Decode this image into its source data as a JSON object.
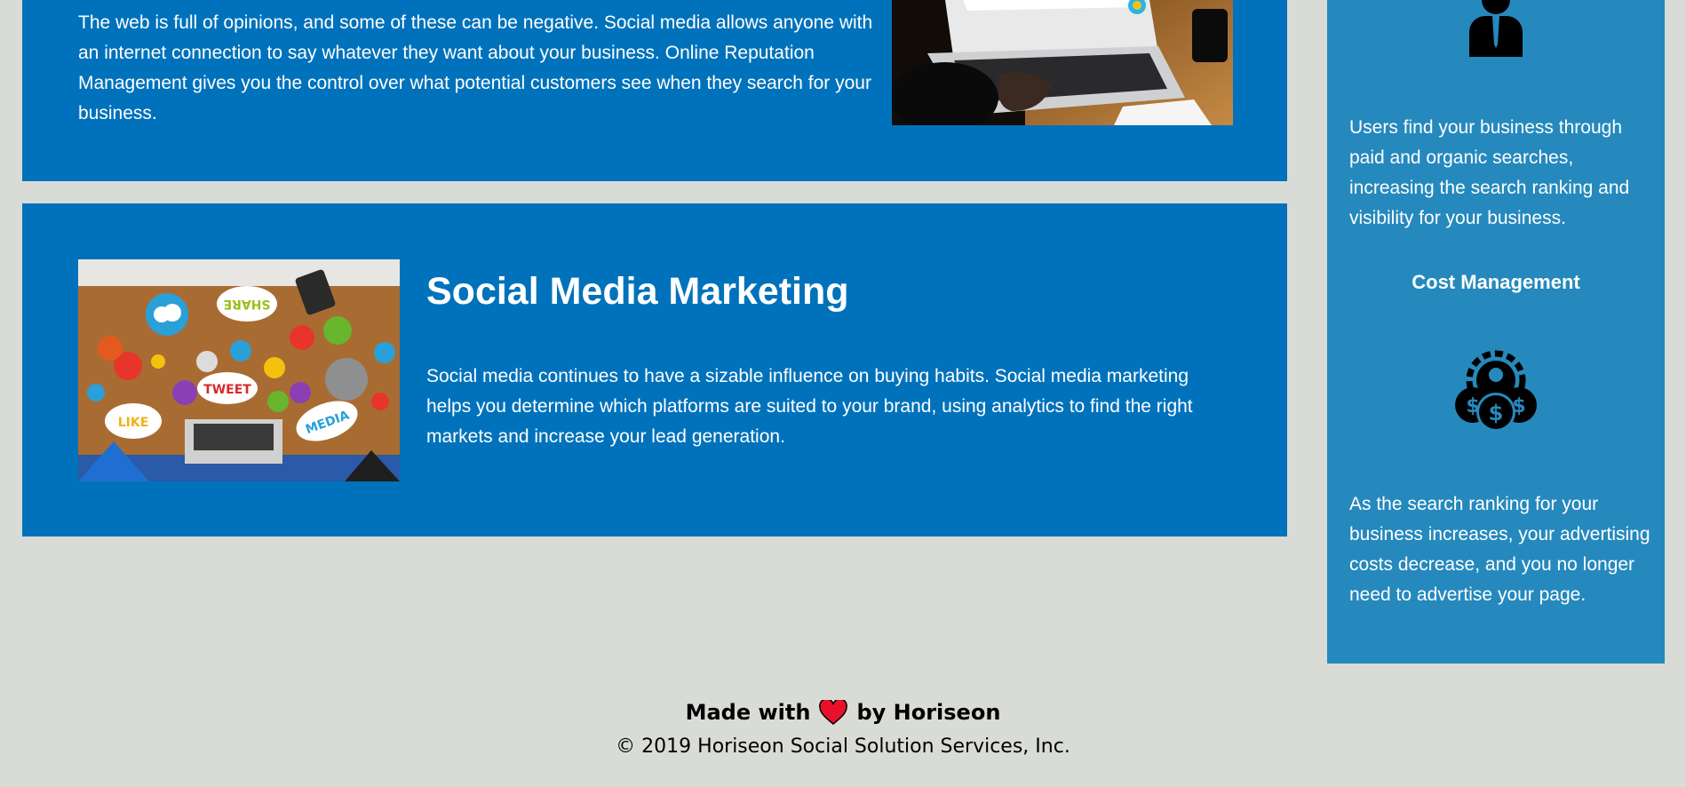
{
  "sections": {
    "top": {
      "text": "The web is full of opinions, and some of these can be negative. Social media allows anyone with an internet connection to say whatever they want about your business. Online Reputation Management gives you the control over what potential customers see when they search for your business."
    },
    "social": {
      "title": "Social Media Marketing",
      "text": "Social media continues to have a sizable influence on buying habits. Social media marketing helps you determine which platforms are suited to your brand, using analytics to find the right markets and increase your lead generation.",
      "image_words": [
        "SHARE",
        "TWEET",
        "LIKE",
        "MEDIA"
      ]
    }
  },
  "sidebar": {
    "items": [
      {
        "icon": "lightbulb-person-icon",
        "text": "Users find your business through paid and organic searches, increasing the search ranking and visibility for your business."
      },
      {
        "title": "Cost Management",
        "icon": "cost-gears-coins-icon",
        "text": "As the search ranking for your business increases, your advertising costs decrease, and you no longer need to advertise your page."
      }
    ]
  },
  "footer": {
    "made_with": "Made with",
    "heart_icon": "heart-icon",
    "by": "by Horiseon",
    "copyright": "© 2019 Horiseon Social Solution Services, Inc."
  },
  "colors": {
    "background": "#d9dcd6",
    "card": "#0072bb",
    "sidebar": "#2589bd",
    "heart": "#e8102a"
  }
}
